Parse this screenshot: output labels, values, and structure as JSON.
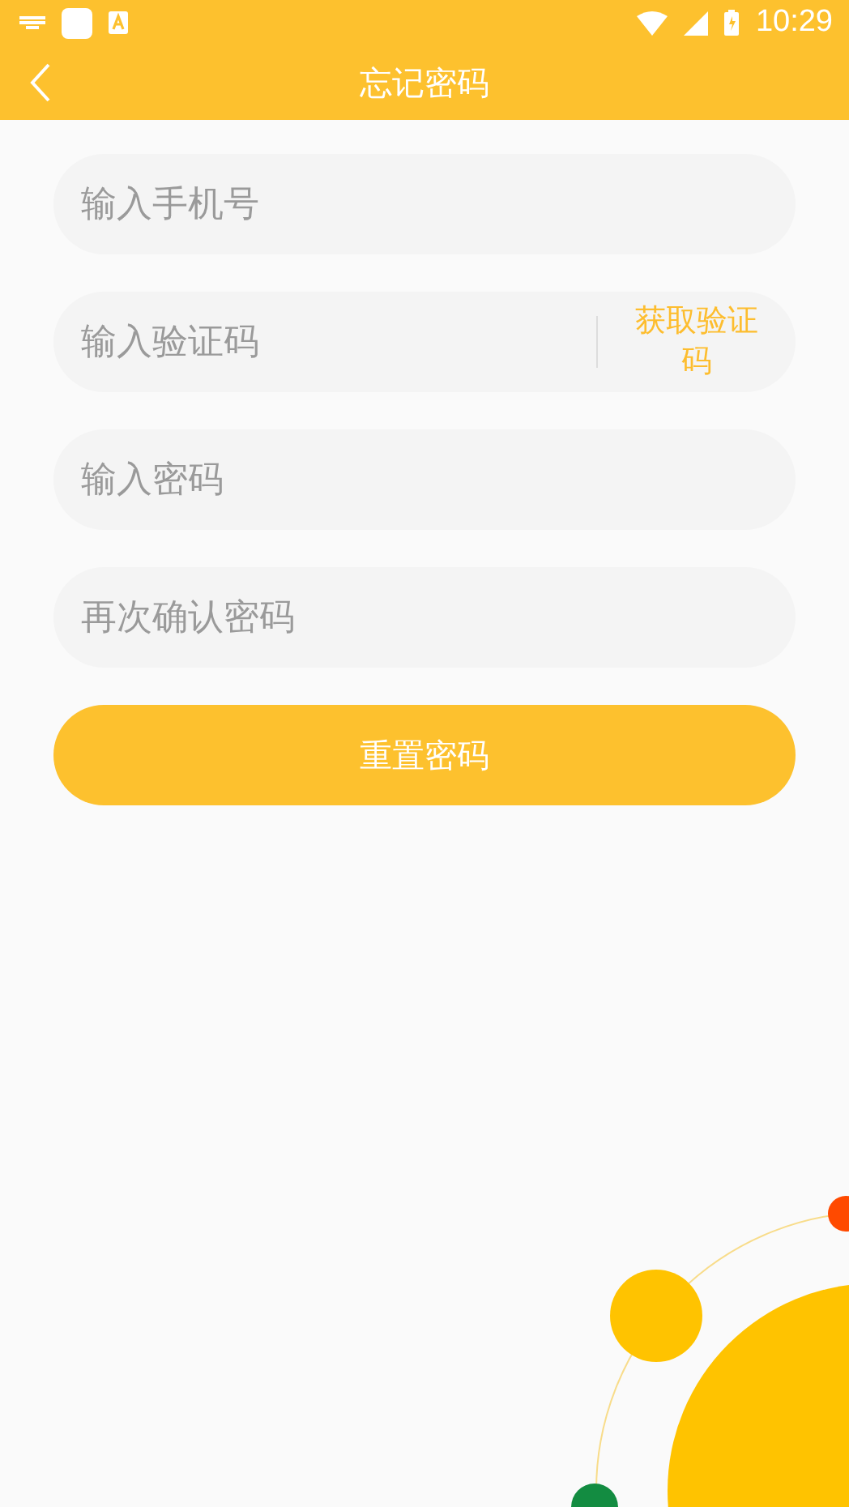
{
  "status_bar": {
    "time": "10:29"
  },
  "toolbar": {
    "title": "忘记密码"
  },
  "fields": [
    {
      "kind": "plain",
      "placeholder": "输入手机号"
    },
    {
      "kind": "code",
      "placeholder": "输入验证码",
      "action": "获取验证码"
    },
    {
      "kind": "plain",
      "placeholder": "输入密码"
    },
    {
      "kind": "plain",
      "placeholder": "再次确认密码"
    }
  ],
  "submit": {
    "label": "重置密码"
  }
}
